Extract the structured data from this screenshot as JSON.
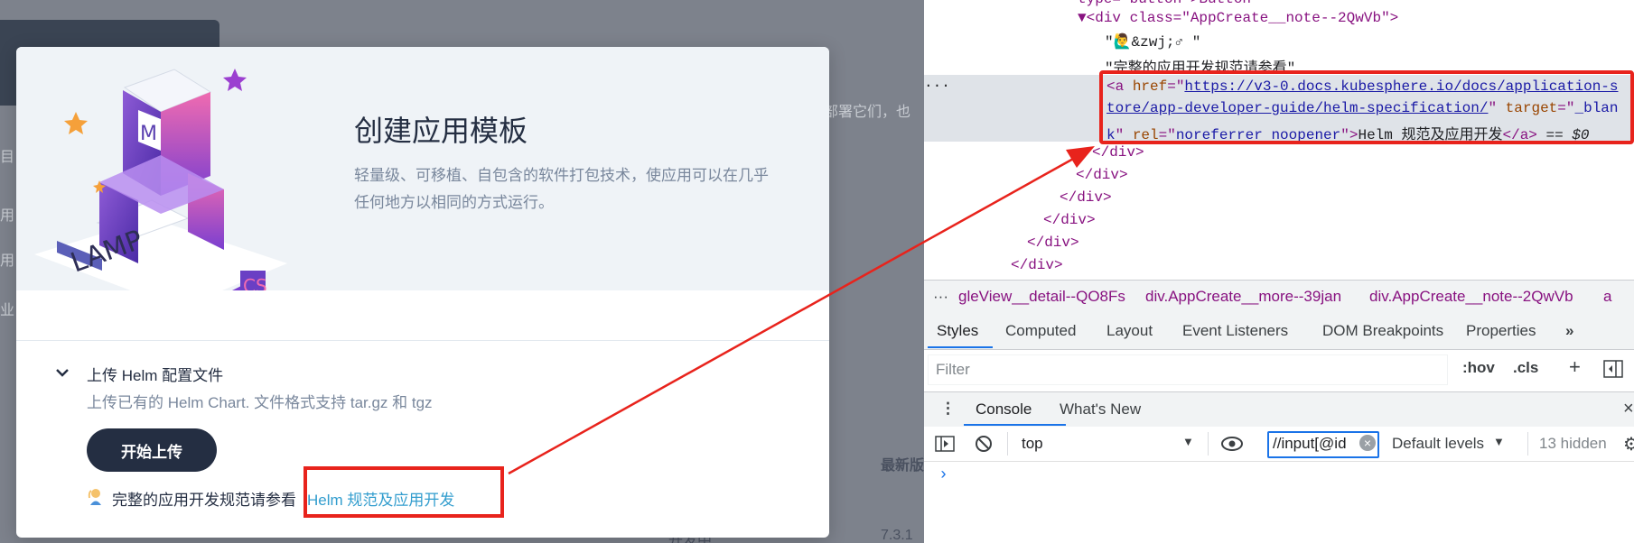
{
  "background": {
    "side_labels": [
      "目",
      "用",
      "用",
      "业"
    ],
    "desc_fragment": "部署它们，也",
    "column_header": "最新版",
    "row_value": "7.3.1",
    "row_status": "开发中"
  },
  "modal": {
    "title": "创建应用模板",
    "description": "轻量级、可移植、自包含的软件打包技术，使应用可以在几乎任何地方以相同的方式运行。",
    "illustration_text": "LAMP",
    "upload": {
      "title": "上传 Helm 配置文件",
      "description": "上传已有的 Helm Chart. 文件格式支持 tar.gz 和 tgz",
      "button": "开始上传"
    },
    "note": {
      "text": "完整的应用开发规范请参看",
      "link_text": "Helm 规范及应用开发"
    }
  },
  "devtools": {
    "dom": {
      "line_div_open": "<div class=\"AppCreate__note--2QwVb\">",
      "line_entity": "\"🙋‍♂️&zwj;♂ \"",
      "line_text": "\"完整的应用开发规范请参看\"",
      "href_part1": "https://v3-0.docs.kubesphere.io/docs/application-s",
      "href_part2": "tore/app-developer-guide/helm-specification/",
      "target_part1": "_blan",
      "target_part2": "k",
      "rel": "noreferrer noopener",
      "link_text": "Helm 规范及应用开发",
      "selected_marker": "== $0",
      "close_div": "</div>"
    },
    "breadcrumbs": [
      "gleView__detail--QO8Fs",
      "div.AppCreate__more--39jan",
      "div.AppCreate__note--2QwVb",
      "a"
    ],
    "tabs": [
      "Styles",
      "Computed",
      "Layout",
      "Event Listeners",
      "DOM Breakpoints",
      "Properties"
    ],
    "filter_placeholder": "Filter",
    "hov": ":hov",
    "cls": ".cls",
    "drawer_tabs": [
      "Console",
      "What's New"
    ],
    "context": "top",
    "console_filter": "//input[@id",
    "levels": "Default levels",
    "hidden_count": "13 hidden",
    "prompt": "›"
  },
  "colors": {
    "annotation": "#e8231c",
    "link": "#329dce",
    "button": "#242e42",
    "selected_tab": "#1a73e8"
  }
}
